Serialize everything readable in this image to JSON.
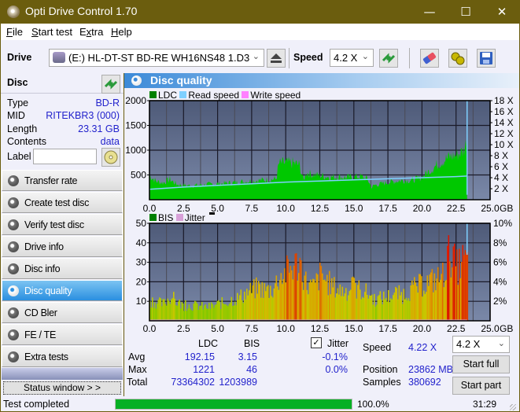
{
  "window": {
    "title": "Opti Drive Control 1.70",
    "minimize_glyph": "—",
    "maximize_glyph": "☐",
    "close_glyph": "✕"
  },
  "menu": [
    {
      "label": "File",
      "accel": "F",
      "rest": "ile"
    },
    {
      "label": "Start test",
      "accel": "S",
      "rest": "tart test"
    },
    {
      "label": "Extra",
      "accel": "x",
      "pre": "E",
      "rest": "tra"
    },
    {
      "label": "Help",
      "accel": "H",
      "rest": "elp"
    }
  ],
  "toolbar": {
    "drive_label": "Drive",
    "drive_value": "(E:)  HL-DT-ST BD-RE  WH16NS48 1.D3",
    "speed_label": "Speed",
    "speed_value": "4.2 X",
    "icons": [
      "drive-icon",
      "eject-icon",
      "refresh-icon",
      "eraser-icon",
      "settings-icon",
      "save-icon"
    ]
  },
  "disc": {
    "header": "Disc",
    "rows": [
      {
        "key": "Type",
        "value": "BD-R"
      },
      {
        "key": "MID",
        "value": "RITEKBR3 (000)"
      },
      {
        "key": "Length",
        "value": "23.31 GB"
      },
      {
        "key": "Contents",
        "value": "data"
      }
    ],
    "label_key": "Label",
    "label_value": ""
  },
  "nav": [
    {
      "label": "Transfer rate",
      "active": false
    },
    {
      "label": "Create test disc",
      "active": false
    },
    {
      "label": "Verify test disc",
      "active": false
    },
    {
      "label": "Drive info",
      "active": false
    },
    {
      "label": "Disc info",
      "active": false
    },
    {
      "label": "Disc quality",
      "active": true
    },
    {
      "label": "CD Bler",
      "active": false
    },
    {
      "label": "FE / TE",
      "active": false
    },
    {
      "label": "Extra tests",
      "active": false
    }
  ],
  "status_window_button": "Status window > >",
  "panel_title": "Disc quality",
  "chart_data": [
    {
      "type": "area",
      "title": "LDC",
      "legend": [
        {
          "name": "LDC",
          "color": "#008000"
        },
        {
          "name": "Read speed",
          "color": "#7fd0ff"
        },
        {
          "name": "Write speed",
          "color": "#ff80ff"
        }
      ],
      "legend_position": "top-left",
      "xlabel": "GB",
      "x_ticks": [
        "0.0",
        "2.5",
        "5.0",
        "7.5",
        "10.0",
        "12.5",
        "15.0",
        "17.5",
        "20.0",
        "22.5",
        "25.0"
      ],
      "xlim": [
        0,
        25
      ],
      "y_ticks": [
        "500",
        "1000",
        "1500",
        "2000"
      ],
      "ylim": [
        0,
        2000
      ],
      "y2_ticks": [
        "2 X",
        "4 X",
        "6 X",
        "8 X",
        "10 X",
        "12 X",
        "14 X",
        "16 X",
        "18 X"
      ],
      "y2lim": [
        0,
        18
      ],
      "grid": true,
      "ldc_x": [
        0,
        0.5,
        1,
        1.5,
        2,
        2.5,
        3,
        3.5,
        4,
        4.5,
        5,
        5.5,
        6,
        6.5,
        7,
        7.5,
        8,
        8.5,
        9,
        9.3,
        9.5,
        10,
        10.5,
        11,
        11.3,
        11.5,
        12,
        12.5,
        13,
        13.5,
        14,
        14.5,
        15,
        15.5,
        16,
        16.3,
        16.5,
        17,
        17.5,
        18,
        18.5,
        19,
        19.5,
        20,
        20.5,
        21,
        21.5,
        22,
        22.5,
        23,
        23.3
      ],
      "ldc_values": [
        500,
        380,
        350,
        420,
        320,
        300,
        290,
        300,
        310,
        320,
        330,
        340,
        350,
        360,
        380,
        390,
        400,
        410,
        420,
        430,
        750,
        760,
        760,
        720,
        400,
        560,
        520,
        500,
        480,
        470,
        470,
        460,
        470,
        480,
        430,
        250,
        300,
        330,
        360,
        380,
        400,
        400,
        420,
        470,
        580,
        700,
        800,
        880,
        920,
        1000,
        1200
      ],
      "read_speed_x": [
        0,
        2.5,
        5,
        7.5,
        10,
        12.5,
        15,
        17.5,
        20,
        22.5,
        23.3
      ],
      "read_speed_values": [
        1.9,
        2.3,
        2.6,
        2.9,
        3.2,
        3.4,
        3.6,
        3.8,
        4.0,
        4.2,
        4.3
      ],
      "end_marker_gb": 23.31
    },
    {
      "type": "bar",
      "title": "BIS",
      "legend": [
        {
          "name": "BIS",
          "color": "#008000"
        },
        {
          "name": "Jitter",
          "color": "#d8a0d8"
        }
      ],
      "legend_position": "top-left",
      "xlabel": "GB",
      "x_ticks": [
        "0.0",
        "2.5",
        "5.0",
        "7.5",
        "10.0",
        "12.5",
        "15.0",
        "17.5",
        "20.0",
        "22.5",
        "25.0"
      ],
      "xlim": [
        0,
        25
      ],
      "y_ticks": [
        "10",
        "20",
        "30",
        "40",
        "50"
      ],
      "ylim": [
        0,
        50
      ],
      "y2_ticks": [
        "2%",
        "4%",
        "6%",
        "8%",
        "10%"
      ],
      "y2lim": [
        0,
        10
      ],
      "grid": true,
      "bis_x": [
        0,
        0.5,
        1,
        1.5,
        2,
        2.5,
        3,
        3.5,
        4,
        4.5,
        5,
        5.5,
        6,
        6.5,
        7,
        7.5,
        8,
        8.5,
        9,
        9.5,
        10,
        10.5,
        11,
        11.5,
        12,
        12.5,
        13,
        13.5,
        14,
        14.5,
        15,
        15.5,
        16,
        16.5,
        17,
        17.5,
        18,
        18.5,
        19,
        19.5,
        20,
        20.5,
        21,
        21.5,
        22,
        22.5,
        23,
        23.3
      ],
      "bis_values": [
        14,
        12,
        11,
        16,
        12,
        10,
        10,
        10,
        9,
        9,
        11,
        12,
        14,
        15,
        18,
        20,
        22,
        20,
        21,
        29,
        32,
        36,
        38,
        24,
        22,
        30,
        26,
        22,
        20,
        20,
        22,
        20,
        18,
        14,
        15,
        16,
        18,
        17,
        20,
        22,
        24,
        26,
        27,
        30,
        46,
        35,
        40,
        38
      ],
      "end_marker_gb": 23.31
    }
  ],
  "stats": {
    "col_ldc": "LDC",
    "col_bis": "BIS",
    "jitter_label": "Jitter",
    "jitter_checked": true,
    "rows": [
      {
        "label": "Avg",
        "ldc": "192.15",
        "bis": "3.15",
        "jitter": "-0.1%"
      },
      {
        "label": "Max",
        "ldc": "1221",
        "bis": "46",
        "jitter": "0.0%"
      },
      {
        "label": "Total",
        "ldc": "73364302",
        "bis": "1203989",
        "jitter": ""
      }
    ],
    "speed_label": "Speed",
    "speed_value": "4.22 X",
    "position_label": "Position",
    "position_value": "23862 MB",
    "samples_label": "Samples",
    "samples_value": "380692",
    "speed_select": "4.2 X",
    "start_full": "Start full",
    "start_part": "Start part"
  },
  "statusbar": {
    "status": "Test completed",
    "progress_percent": 100,
    "progress_text": "100.0%",
    "time": "31:29"
  }
}
